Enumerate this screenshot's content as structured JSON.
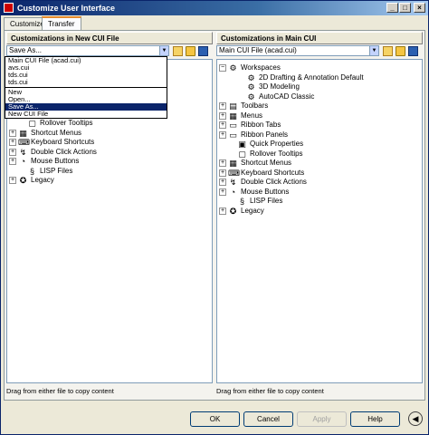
{
  "window": {
    "title": "Customize User Interface",
    "controls": [
      "_",
      "□",
      "×"
    ]
  },
  "tabs": [
    {
      "label": "Customize"
    },
    {
      "label": "Transfer"
    }
  ],
  "left": {
    "header": "Customizations in New CUI File",
    "combo_value": "Save As...",
    "status": "Drag from either file to copy content",
    "dropdown": {
      "items": [
        "Main CUI File (acad.cui)",
        "avs.cui",
        "tds.cui",
        "tds.cui"
      ],
      "actions": [
        "New",
        "Open...",
        "Save As...",
        "New CUI File"
      ]
    },
    "tree": [
      {
        "label": "Rollover Tooltips",
        "icon": "tooltip-icon",
        "level": 1,
        "expander": ""
      },
      {
        "label": "Shortcut Menus",
        "icon": "menu-icon",
        "level": 0,
        "expander": "+"
      },
      {
        "label": "Keyboard Shortcuts",
        "icon": "keyboard-icon",
        "level": 0,
        "expander": "+"
      },
      {
        "label": "Double Click Actions",
        "icon": "double-click-icon",
        "level": 0,
        "expander": "+"
      },
      {
        "label": "Mouse Buttons",
        "icon": "mouse-icon",
        "level": 0,
        "expander": "+"
      },
      {
        "label": "LISP Files",
        "icon": "lisp-icon",
        "level": 1,
        "expander": ""
      },
      {
        "label": "Legacy",
        "icon": "legacy-icon",
        "level": 0,
        "expander": "+"
      }
    ]
  },
  "right": {
    "header": "Customizations in Main CUI",
    "combo_value": "Main CUI File (acad.cui)",
    "status": "Drag from either file to copy content",
    "tree": [
      {
        "label": "Workspaces",
        "icon": "workspaces-icon",
        "level": 0,
        "expander": "−"
      },
      {
        "label": "2D Drafting & Annotation Default",
        "icon": "gear-icon",
        "level": 2,
        "expander": ""
      },
      {
        "label": "3D Modeling",
        "icon": "gear-icon",
        "level": 2,
        "expander": ""
      },
      {
        "label": "AutoCAD Classic",
        "icon": "gear-icon",
        "level": 2,
        "expander": ""
      },
      {
        "label": "Toolbars",
        "icon": "toolbar-icon",
        "level": 0,
        "expander": "+"
      },
      {
        "label": "Menus",
        "icon": "menu-icon",
        "level": 0,
        "expander": "+"
      },
      {
        "label": "Ribbon Tabs",
        "icon": "ribbon-icon",
        "level": 0,
        "expander": "+"
      },
      {
        "label": "Ribbon Panels",
        "icon": "ribbon-icon",
        "level": 0,
        "expander": "+"
      },
      {
        "label": "Quick Properties",
        "icon": "properties-icon",
        "level": 1,
        "expander": ""
      },
      {
        "label": "Rollover Tooltips",
        "icon": "tooltip-icon",
        "level": 1,
        "expander": ""
      },
      {
        "label": "Shortcut Menus",
        "icon": "menu-icon",
        "level": 0,
        "expander": "+"
      },
      {
        "label": "Keyboard Shortcuts",
        "icon": "keyboard-icon",
        "level": 0,
        "expander": "+"
      },
      {
        "label": "Double Click Actions",
        "icon": "double-click-icon",
        "level": 0,
        "expander": "+"
      },
      {
        "label": "Mouse Buttons",
        "icon": "mouse-icon",
        "level": 0,
        "expander": "+"
      },
      {
        "label": "LISP Files",
        "icon": "lisp-icon",
        "level": 1,
        "expander": ""
      },
      {
        "label": "Legacy",
        "icon": "legacy-icon",
        "level": 0,
        "expander": "+"
      }
    ]
  },
  "buttons": {
    "ok": "OK",
    "cancel": "Cancel",
    "apply": "Apply",
    "help": "Help",
    "collapse": "◀"
  }
}
